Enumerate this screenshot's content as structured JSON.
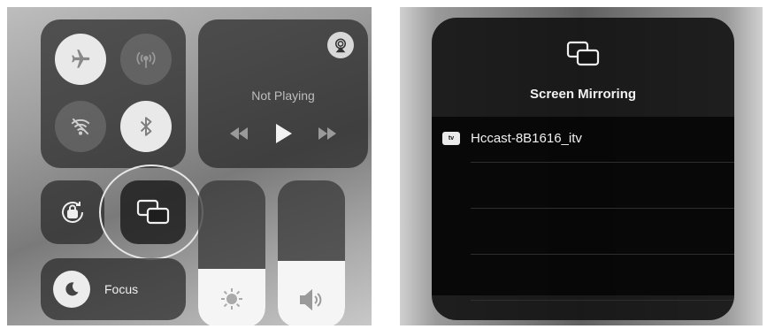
{
  "control_center": {
    "connectivity": {
      "airplane_icon": "airplane-icon",
      "cellular_icon": "cellular-icon",
      "wifi_icon": "wifi-off-icon",
      "bluetooth_icon": "bluetooth-icon"
    },
    "now_playing": {
      "status": "Not Playing"
    },
    "focus": {
      "label": "Focus"
    },
    "brightness_level": 0.4,
    "volume_level": 0.45
  },
  "screen_mirroring": {
    "title": "Screen Mirroring",
    "devices": [
      {
        "badge": "tv",
        "name": "Hccast-8B1616_itv"
      }
    ]
  },
  "colors": {
    "tile_dark": "#2a2a2a",
    "active_circle": "#e9e9e9",
    "ring": "#e6e6e6"
  }
}
